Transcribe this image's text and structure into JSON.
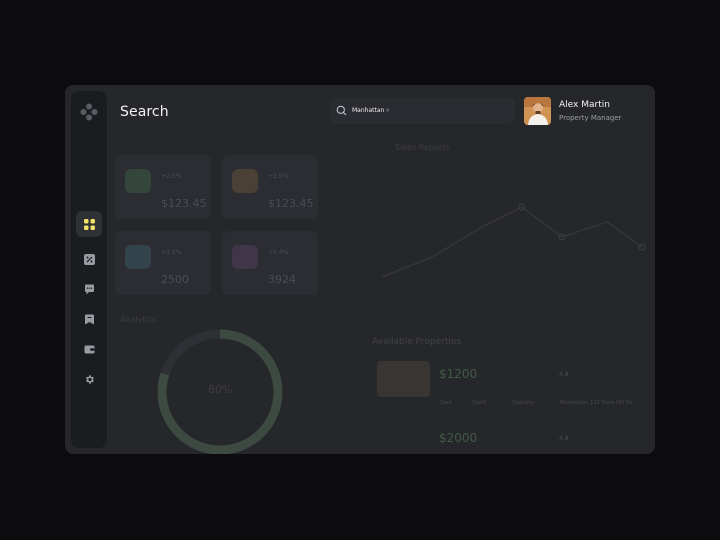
{
  "header": {
    "title": "Search",
    "search": {
      "chip": "Manhattan",
      "chip_close": "×"
    },
    "user": {
      "name": "Alex Martin",
      "role": "Property Manager"
    }
  },
  "sidebar": {
    "items": [
      {
        "icon": "dashboard-grid-icon",
        "active": true
      },
      {
        "icon": "percent-tag-icon"
      },
      {
        "icon": "chat-bubble-icon"
      },
      {
        "icon": "bookmark-icon"
      },
      {
        "icon": "wallet-icon"
      },
      {
        "icon": "settings-gear-icon"
      }
    ]
  },
  "stats": [
    {
      "change": "+2.5%",
      "value": "$123.45",
      "color": "#34463c"
    },
    {
      "change": "+2.5%",
      "value": "$123.45",
      "color": "#4a4035"
    },
    {
      "change": "+3.5%",
      "value": "2500",
      "color": "#33444d"
    },
    {
      "change": "+5.4%",
      "value": "3924",
      "color": "#41354a"
    }
  ],
  "sections": {
    "sales": "Sales Reports",
    "analytics": "Analytics",
    "properties": "Available Properties"
  },
  "analytics": {
    "percent": "80%",
    "progress": 0.8
  },
  "properties": [
    {
      "price": "$1200",
      "rating": "4.8",
      "meta": [
        "2bed",
        "1bath",
        "1balcony",
        "Manhattan, 123 State Hill Str"
      ]
    },
    {
      "price": "$2000",
      "rating": "4.8",
      "meta": []
    }
  ],
  "colors": {
    "accent": "#f4e06b",
    "bg": "#26272b",
    "sidebar": "#1b1c20"
  }
}
